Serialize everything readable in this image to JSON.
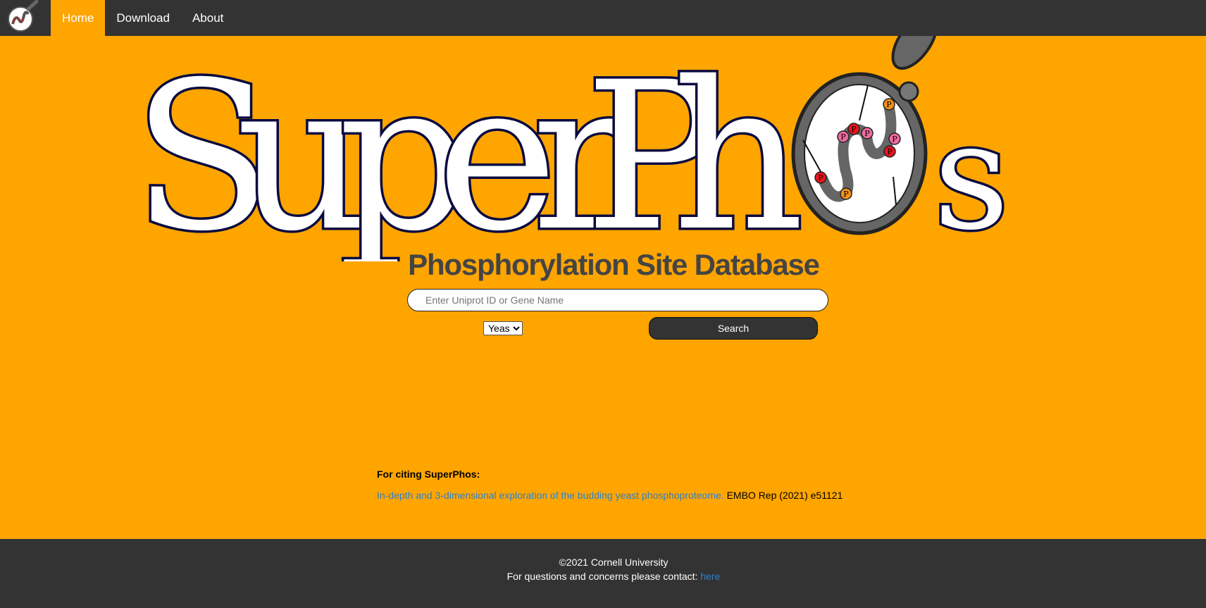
{
  "nav": {
    "items": [
      {
        "label": "Home",
        "active": true
      },
      {
        "label": "Download",
        "active": false
      },
      {
        "label": "About",
        "active": false
      }
    ]
  },
  "logo": {
    "letters": [
      "S",
      "u",
      "p",
      "e",
      "r",
      "P",
      "h",
      "s"
    ],
    "phospho_markers": [
      "P",
      "P",
      "P",
      "P",
      "P",
      "P",
      "P",
      "P"
    ]
  },
  "main": {
    "subtitle": "Phosphorylation Site Database",
    "search": {
      "placeholder": "Enter Uniprot ID or Gene Name",
      "value": ""
    },
    "species": {
      "selected": "Yeast"
    },
    "search_button": "Search"
  },
  "citation": {
    "heading": "For citing SuperPhos:",
    "link_text": "In-depth and 3-dimensional exploration of the budding yeast phosphoproteome.",
    "journal": "EMBO Rep (2021) e51121"
  },
  "footer": {
    "copyright": "©2021 Cornell University",
    "contact_prefix": "For questions and concerns please contact:",
    "contact_link": "here"
  },
  "colors": {
    "background": "#FFA500",
    "navbar": "#333333",
    "link": "#2f80c8",
    "logo_outline": "#0a0a40",
    "marker_red": "#e8141c",
    "marker_pink": "#f06aa0",
    "marker_orange": "#f0901a"
  }
}
